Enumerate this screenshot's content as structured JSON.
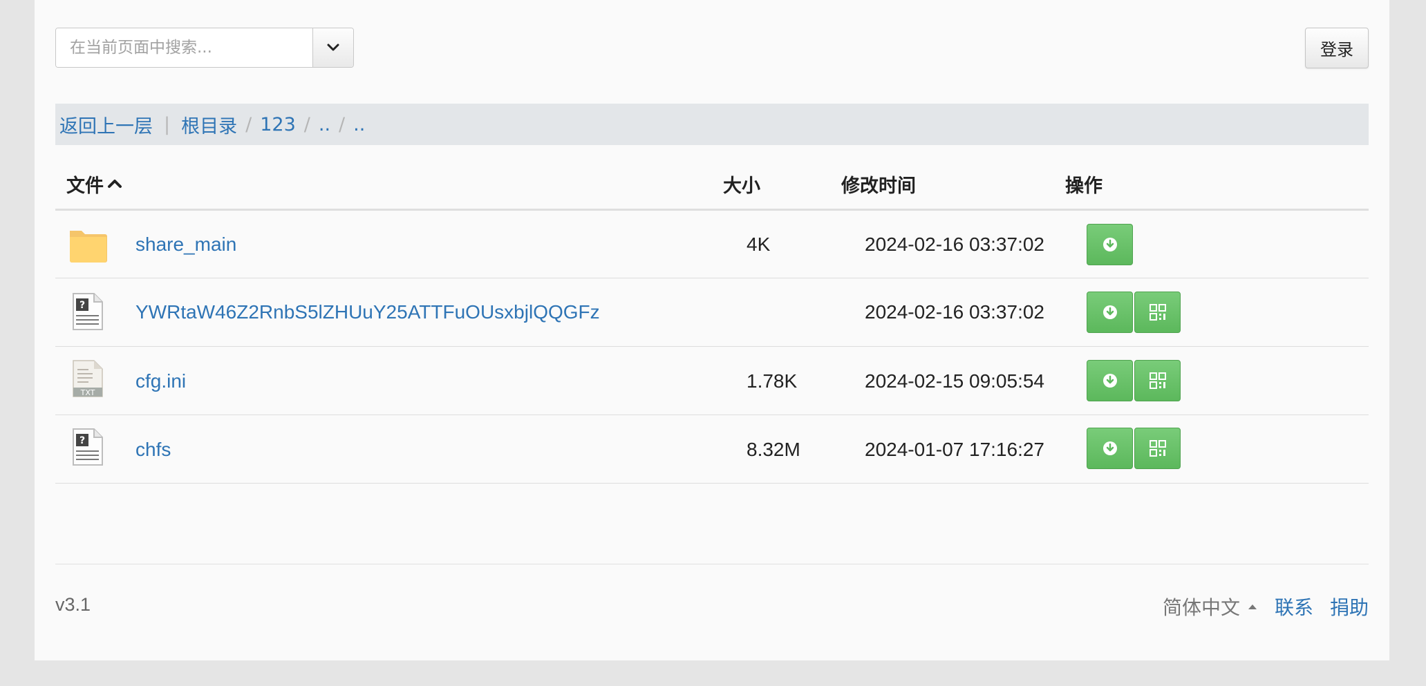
{
  "search": {
    "placeholder": "在当前页面中搜索..."
  },
  "toolbar": {
    "login_label": "登录"
  },
  "breadcrumb": {
    "back_label": "返回上一层",
    "separator": "|",
    "items": [
      "根目录",
      "123",
      "..",
      ".."
    ],
    "divider": "/"
  },
  "table": {
    "columns": [
      "文件",
      "大小",
      "修改时间",
      "操作"
    ],
    "rows": [
      {
        "name": "share_main",
        "size": "4K",
        "time": "2024-02-16 03:37:02",
        "icon": "folder-icon",
        "actions": [
          "download-icon"
        ]
      },
      {
        "name": "YWRtaW46Z2RnbS5lZHUuY25ATTFuOUsxbjlQQGFz",
        "size": "",
        "time": "2024-02-16 03:37:02",
        "icon": "unknown-file-icon",
        "actions": [
          "download-icon",
          "qrcode-icon"
        ]
      },
      {
        "name": "cfg.ini",
        "size": "1.78K",
        "time": "2024-02-15 09:05:54",
        "icon": "txt-file-icon",
        "actions": [
          "download-icon",
          "qrcode-icon"
        ]
      },
      {
        "name": "chfs",
        "size": "8.32M",
        "time": "2024-01-07 17:16:27",
        "icon": "unknown-file-icon",
        "actions": [
          "download-icon",
          "qrcode-icon"
        ]
      }
    ]
  },
  "footer": {
    "version": "v3.1",
    "language": "简体中文",
    "contact": "联系",
    "donate": "捐助"
  },
  "colors": {
    "link": "#2e74b5",
    "button_green": "#5cb85c",
    "breadcrumb_bg": "#e3e6e9"
  }
}
